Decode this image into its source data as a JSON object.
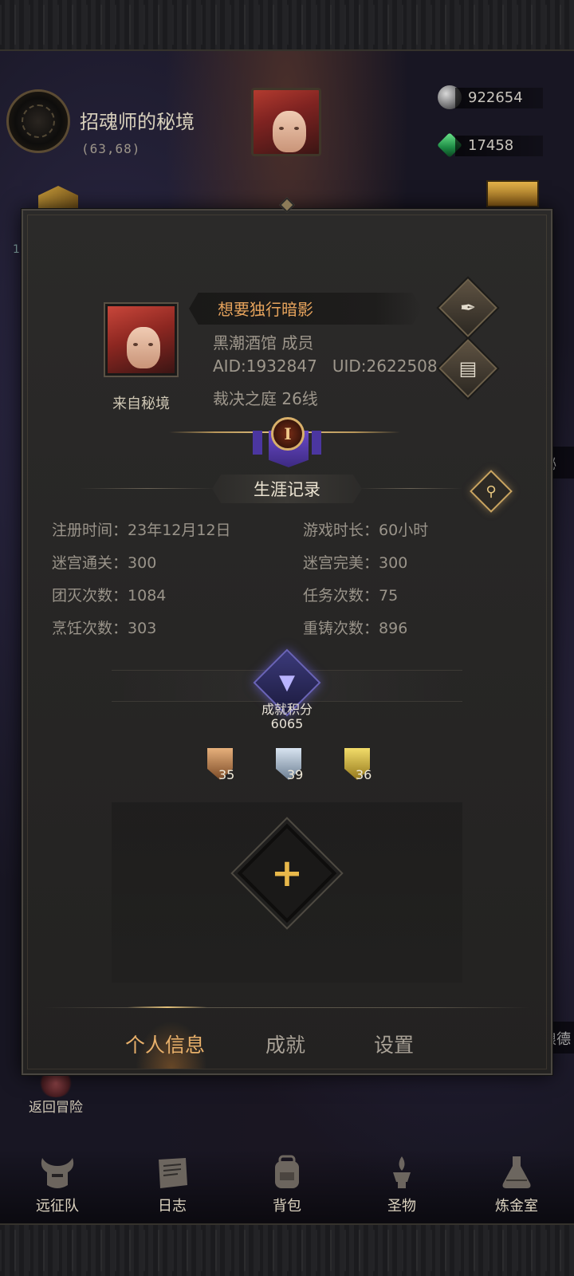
{
  "location": {
    "title": "招魂师的秘境",
    "coords": "(63,68)"
  },
  "currency": {
    "silver": "922654",
    "gems": "17458"
  },
  "side": {
    "right_tag": "秘",
    "right_tag2": "狼德",
    "left_number": "1"
  },
  "return_button": "返回冒险",
  "profile": {
    "name": "想要独行暗影",
    "guild": "黑潮酒馆 成员",
    "ids": "AID:1932847   UID:2622508",
    "server": "裁决之庭 26线",
    "avatar_caption": "来自秘境",
    "rank_numeral": "I"
  },
  "career": {
    "title": "生涯记录",
    "stats": [
      {
        "label": "注册时间：",
        "value": "23年12月12日"
      },
      {
        "label": "游戏时长：",
        "value": "60小时"
      },
      {
        "label": "迷宫通关：",
        "value": "300"
      },
      {
        "label": "迷宫完美：",
        "value": "300"
      },
      {
        "label": "团灭次数：",
        "value": "1084"
      },
      {
        "label": "任务次数：",
        "value": "75"
      },
      {
        "label": "烹饪次数：",
        "value": "303"
      },
      {
        "label": "重铸次数：",
        "value": "896"
      }
    ]
  },
  "achievement": {
    "label": "成就积分",
    "score": "6065",
    "medals": [
      {
        "tier": "bronze",
        "count": "35"
      },
      {
        "tier": "silver",
        "count": "39"
      },
      {
        "tier": "gold",
        "count": "36"
      }
    ]
  },
  "tabs": [
    {
      "label": "个人信息",
      "active": true
    },
    {
      "label": "成就",
      "active": false
    },
    {
      "label": "设置",
      "active": false
    }
  ],
  "bottom_nav": [
    {
      "label": "远征队",
      "icon": "helmet-icon"
    },
    {
      "label": "日志",
      "icon": "scroll-icon"
    },
    {
      "label": "背包",
      "icon": "backpack-icon"
    },
    {
      "label": "圣物",
      "icon": "relic-icon"
    },
    {
      "label": "炼金室",
      "icon": "alchemy-icon"
    }
  ]
}
